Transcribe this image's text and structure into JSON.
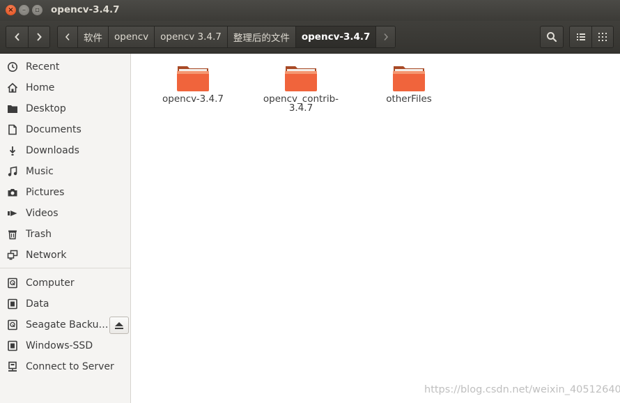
{
  "window": {
    "title": "opencv-3.4.7",
    "close_glyph": "×",
    "minimize_glyph": "–",
    "maximize_glyph": "▫"
  },
  "toolbar": {
    "back_icon": "chevron-left-icon",
    "forward_icon": "chevron-right-icon",
    "breadcrumbs": [
      "软件",
      "opencv",
      "opencv 3.4.7",
      "整理后的文件",
      "opencv-3.4.7"
    ],
    "active_crumb_index": 4,
    "search_icon": "search-icon",
    "view_list_icon": "list-view-icon",
    "view_grid_icon": "grid-view-icon"
  },
  "sidebar": {
    "places": [
      {
        "label": "Recent",
        "icon": "clock-icon"
      },
      {
        "label": "Home",
        "icon": "home-icon"
      },
      {
        "label": "Desktop",
        "icon": "desktop-folder-icon"
      },
      {
        "label": "Documents",
        "icon": "document-icon"
      },
      {
        "label": "Downloads",
        "icon": "download-icon"
      },
      {
        "label": "Music",
        "icon": "music-icon"
      },
      {
        "label": "Pictures",
        "icon": "camera-icon"
      },
      {
        "label": "Videos",
        "icon": "video-icon"
      },
      {
        "label": "Trash",
        "icon": "trash-icon"
      },
      {
        "label": "Network",
        "icon": "network-icon"
      }
    ],
    "devices": [
      {
        "label": "Computer",
        "icon": "drive-icon"
      },
      {
        "label": "Data",
        "icon": "chip-drive-icon"
      },
      {
        "label": "Seagate Backu…",
        "icon": "drive-icon",
        "eject": true
      },
      {
        "label": "Windows-SSD",
        "icon": "chip-drive-icon"
      },
      {
        "label": "Connect to Server",
        "icon": "server-icon"
      }
    ]
  },
  "files": [
    {
      "name": "opencv-3.4.7",
      "type": "folder"
    },
    {
      "name": "opencv_contrib-\n3.4.7",
      "type": "folder"
    },
    {
      "name": "otherFiles",
      "type": "folder"
    }
  ],
  "colors": {
    "folder_orange": "#f0643c",
    "folder_orange_light": "#f6a07a",
    "titlebar": "#3c3b37",
    "sidebar_bg": "#f5f4f2"
  },
  "watermark": "https://blog.csdn.net/weixin_40512640"
}
